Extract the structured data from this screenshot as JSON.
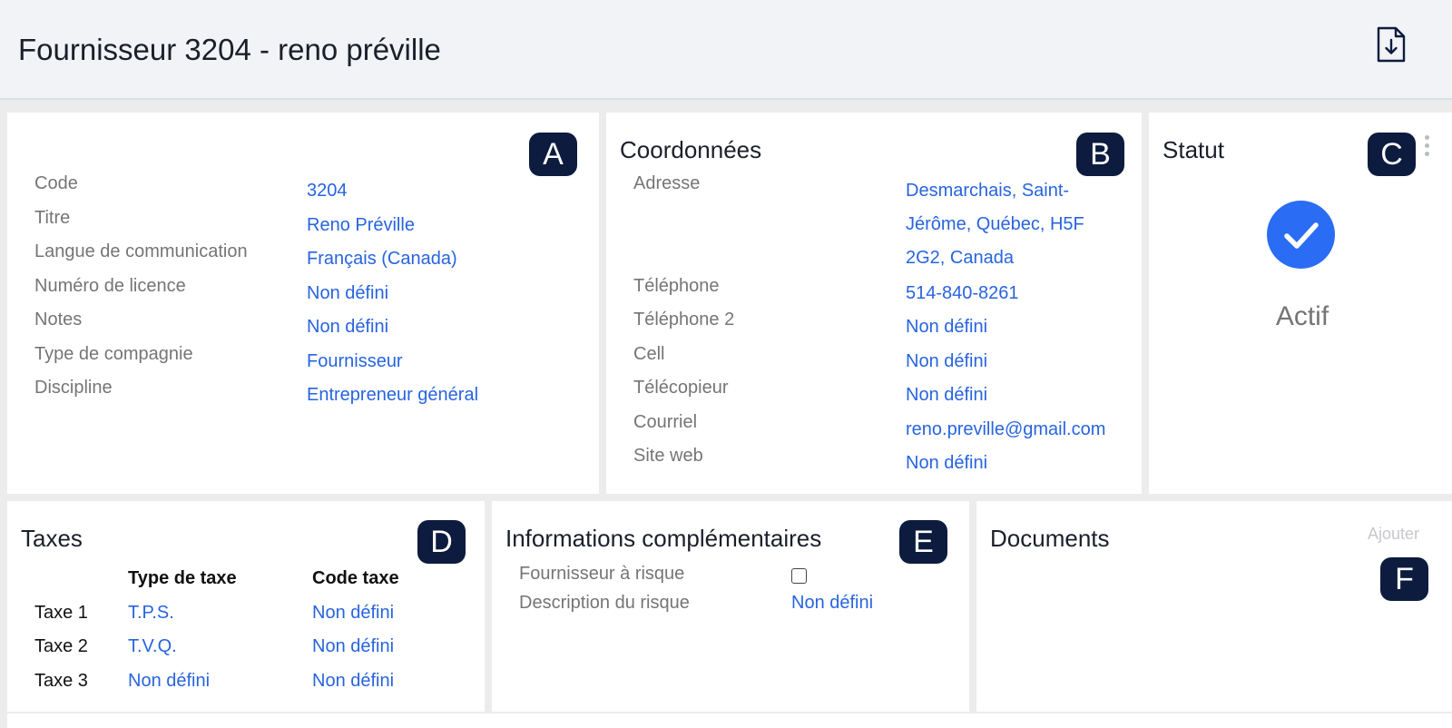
{
  "header": {
    "title": "Fournisseur 3204 - reno préville",
    "export_icon": "file-download-icon"
  },
  "general": {
    "badge": "A",
    "rows": [
      {
        "label": "Code",
        "value": "3204"
      },
      {
        "label": "Titre",
        "value": "Reno Préville"
      },
      {
        "label": "Langue de communication",
        "value": "Français (Canada)"
      },
      {
        "label": "Numéro de licence",
        "value": "Non défini"
      },
      {
        "label": "Notes",
        "value": "Non défini"
      },
      {
        "label": "Type de compagnie",
        "value": "Fournisseur"
      },
      {
        "label": "Discipline",
        "value": "Entrepreneur général"
      }
    ]
  },
  "contact": {
    "title": "Coordonnées",
    "badge": "B",
    "address_label": "Adresse",
    "address_value": "Desmarchais, Saint-Jérôme, Québec, H5F 2G2, Canada",
    "rows": [
      {
        "label": "Téléphone",
        "value": "514-840-8261"
      },
      {
        "label": "Téléphone 2",
        "value": "Non défini"
      },
      {
        "label": "Cell",
        "value": "Non défini"
      },
      {
        "label": "Télécopieur",
        "value": "Non défini"
      },
      {
        "label": "Courriel",
        "value": "reno.preville@gmail.com"
      },
      {
        "label": "Site web",
        "value": "Non défini"
      }
    ]
  },
  "status": {
    "title": "Statut",
    "badge": "C",
    "value": "Actif",
    "icon": "check-circle-icon",
    "menu_icon": "kebab-menu-icon",
    "color": "#2a6df4"
  },
  "taxes": {
    "title": "Taxes",
    "badge": "D",
    "col_type": "Type de taxe",
    "col_code": "Code taxe",
    "rows": [
      {
        "name": "Taxe 1",
        "type": "T.P.S.",
        "code": "Non défini"
      },
      {
        "name": "Taxe 2",
        "type": "T.V.Q.",
        "code": "Non défini"
      },
      {
        "name": "Taxe 3",
        "type": "Non défini",
        "code": "Non défini"
      }
    ]
  },
  "extra": {
    "title": "Informations complémentaires",
    "badge": "E",
    "risk_label": "Fournisseur à risque",
    "risk_checked": false,
    "desc_label": "Description du risque",
    "desc_value": "Non défini"
  },
  "documents": {
    "title": "Documents",
    "badge": "F",
    "add_label": "Ajouter"
  },
  "colors": {
    "link": "#2764e0",
    "badge_bg": "#0d1b3e",
    "label": "#757575"
  }
}
